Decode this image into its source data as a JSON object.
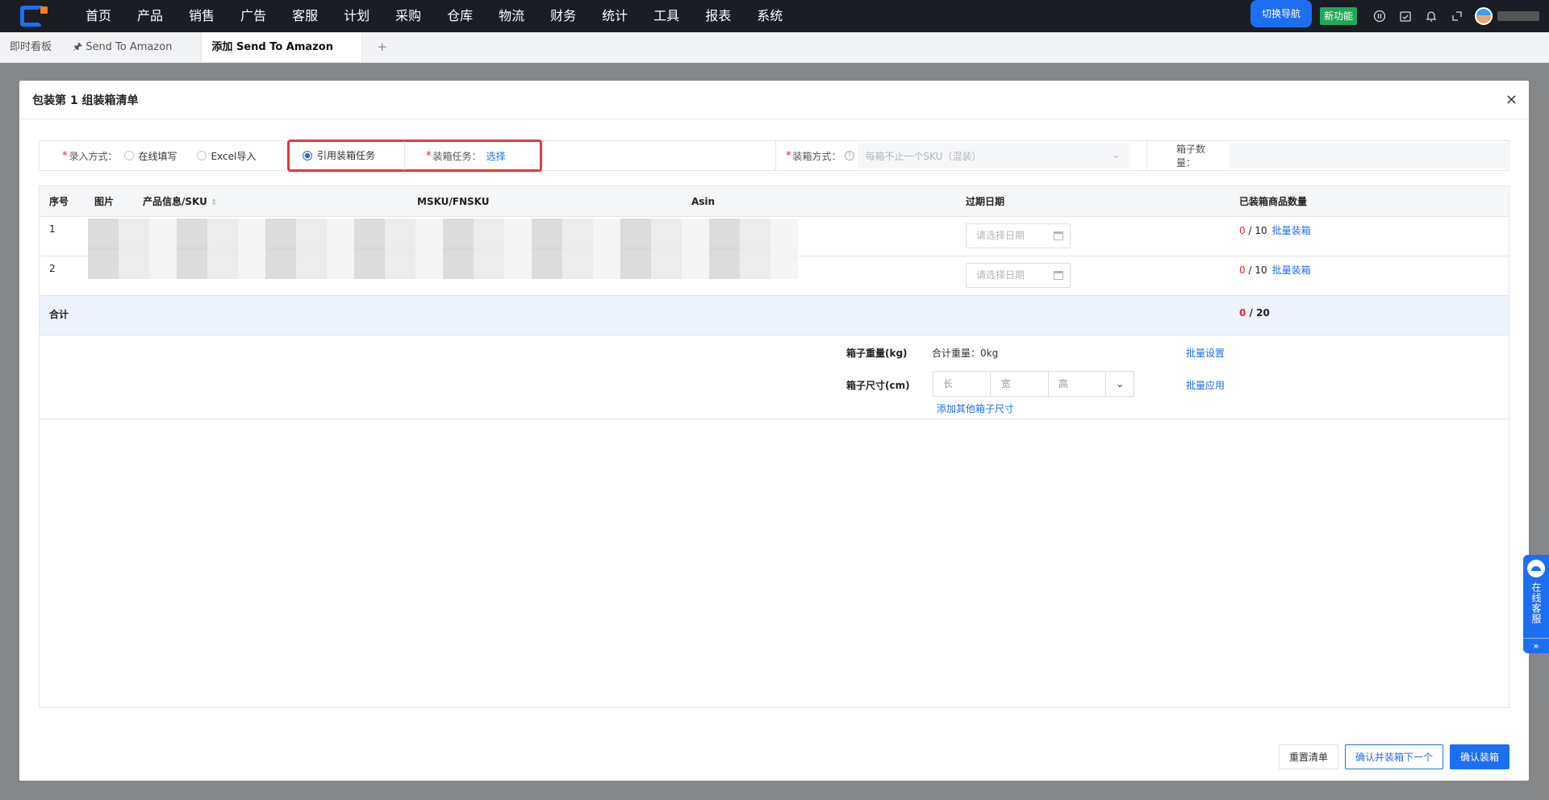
{
  "topnav": {
    "menu": [
      "首页",
      "产品",
      "销售",
      "广告",
      "客服",
      "计划",
      "采购",
      "仓库",
      "物流",
      "财务",
      "统计",
      "工具",
      "报表",
      "系统"
    ],
    "switch_nav": "切换导航",
    "new_feature": "新功能"
  },
  "tabs": {
    "dashboard": "即时看板",
    "send_to_amazon": "Send To Amazon",
    "active": "添加 Send To Amazon",
    "add": "+"
  },
  "modal": {
    "title": "包装第 1 组装箱清单",
    "close": "×",
    "entry_label": "录入方式：",
    "entry_options": [
      "在线填写",
      "Excel导入",
      "引用装箱任务"
    ],
    "entry_selected": "引用装箱任务",
    "task_label": "装箱任务：",
    "task_link": "选择",
    "pack_mode_label": "装箱方式：",
    "pack_mode_value": "每箱不止一个SKU（混装）",
    "box_count_label": "箱子数量："
  },
  "table": {
    "columns": [
      "序号",
      "图片",
      "产品信息/SKU",
      "MSKU/FNSKU",
      "Asin",
      "过期日期",
      "已装箱商品数量"
    ],
    "rows": [
      {
        "index": "1",
        "date_placeholder": "请选择日期",
        "packed": "0",
        "total": "10",
        "batch": "批量装箱"
      },
      {
        "index": "2",
        "date_placeholder": "请选择日期",
        "packed": "0",
        "total": "10",
        "batch": "批量装箱"
      }
    ],
    "total_label": "合计",
    "total_packed": "0",
    "total_all": "20"
  },
  "weight": {
    "label": "箱子重量(kg)",
    "value": "合计重量：0kg",
    "batch": "批量设置"
  },
  "dimension": {
    "label": "箱子尺寸(cm)",
    "length": "长",
    "width": "宽",
    "height": "高",
    "batch": "批量应用",
    "add": "添加其他箱子尺寸"
  },
  "footer": {
    "reset": "重置清单",
    "confirm_next": "确认并装箱下一个",
    "confirm": "确认装箱"
  },
  "service": {
    "text": "在线客服",
    "expand": "»"
  },
  "colors": {
    "primary": "#1d6ff2",
    "danger": "#e23a3a",
    "nav_bg": "#1a1d24",
    "success": "#22a75a"
  }
}
